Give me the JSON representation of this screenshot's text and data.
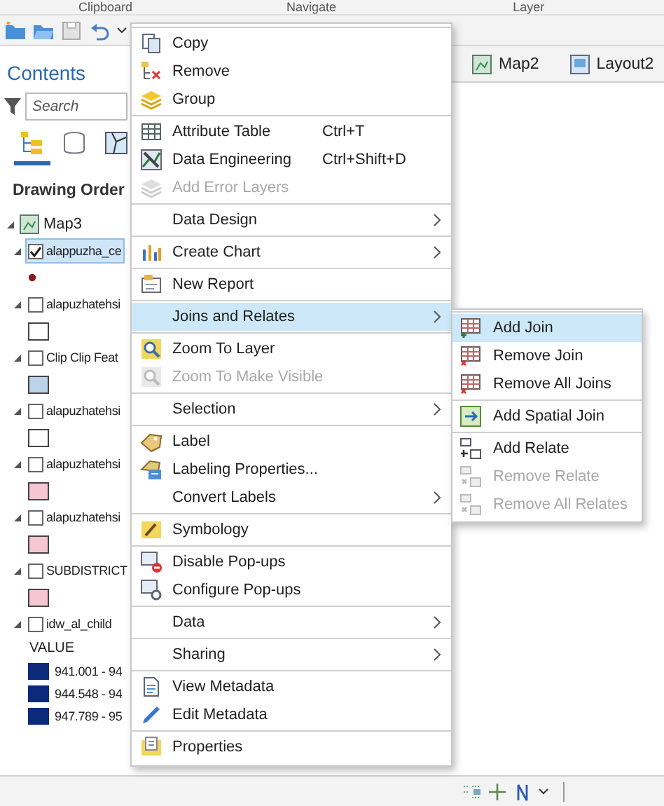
{
  "ribbon": {
    "groups": [
      "Clipboard",
      "Navigate",
      "Layer"
    ]
  },
  "map_tabs": [
    {
      "label": "Map2",
      "kind": "map"
    },
    {
      "label": "Layout2",
      "kind": "layout"
    }
  ],
  "contents": {
    "title": "Contents",
    "search": {
      "placeholder": "Search"
    },
    "views": [
      {
        "selected": true
      },
      {
        "selected": false
      },
      {
        "selected": false
      }
    ],
    "heading": "Drawing Order",
    "map": {
      "name": "Map3",
      "expanded": true,
      "layers": [
        {
          "name": "alappuzha_ce",
          "checked": true,
          "selected": true,
          "expanded": true,
          "symbol": {
            "kind": "point",
            "color": "#8b1a1a"
          }
        },
        {
          "name": "alapuzhatehsi",
          "checked": false,
          "selected": false,
          "expanded": true,
          "symbol": {
            "kind": "fill",
            "color": "#ffffff"
          }
        },
        {
          "name": "Clip Clip Feat",
          "checked": false,
          "selected": false,
          "expanded": true,
          "symbol": {
            "kind": "fill",
            "color": "#bcd3ea"
          }
        },
        {
          "name": "alapuzhatehsi",
          "checked": false,
          "selected": false,
          "expanded": true,
          "symbol": {
            "kind": "fill",
            "color": "#ffffff"
          }
        },
        {
          "name": "alapuzhatehsi",
          "checked": false,
          "selected": false,
          "expanded": true,
          "symbol": {
            "kind": "fill",
            "color": "#f7c6d3"
          }
        },
        {
          "name": "alapuzhatehsi",
          "checked": false,
          "selected": false,
          "expanded": true,
          "symbol": {
            "kind": "fill",
            "color": "#f7c6d3"
          }
        },
        {
          "name": "SUBDISTRICT",
          "checked": false,
          "selected": false,
          "expanded": true,
          "symbol": {
            "kind": "fill",
            "color": "#f7c6d3"
          }
        },
        {
          "name": "idw_al_child",
          "checked": false,
          "selected": false,
          "expanded": true,
          "symbol": {
            "kind": "ramp",
            "heading": "VALUE",
            "classes": [
              {
                "label": "941.001 - 94",
                "color": "#0b2a7c"
              },
              {
                "label": "944.548 - 94",
                "color": "#0b2a7c"
              },
              {
                "label": "947.789 - 95",
                "color": "#0b2a7c"
              }
            ]
          }
        }
      ]
    }
  },
  "context_menu": {
    "sections": [
      {
        "items": [
          {
            "label": "Copy",
            "submenu": false,
            "disabled": false,
            "selected": false
          },
          {
            "label": "Remove",
            "submenu": false,
            "disabled": false,
            "selected": false
          },
          {
            "label": "Group",
            "submenu": false,
            "disabled": false,
            "selected": false
          }
        ]
      },
      {
        "items": [
          {
            "label": "Attribute Table",
            "shortcut": "Ctrl+T",
            "submenu": false,
            "disabled": false,
            "selected": false
          },
          {
            "label": "Data Engineering",
            "shortcut": "Ctrl+Shift+D",
            "submenu": false,
            "disabled": false,
            "selected": false
          },
          {
            "label": "Add Error Layers",
            "submenu": false,
            "disabled": true,
            "selected": false
          }
        ]
      },
      {
        "items": [
          {
            "label": "Data Design",
            "submenu": true,
            "disabled": false,
            "selected": false
          }
        ]
      },
      {
        "items": [
          {
            "label": "Create Chart",
            "submenu": true,
            "disabled": false,
            "selected": false
          }
        ]
      },
      {
        "items": [
          {
            "label": "New Report",
            "submenu": false,
            "disabled": false,
            "selected": false
          }
        ]
      },
      {
        "items": [
          {
            "label": "Joins and Relates",
            "submenu": true,
            "disabled": false,
            "selected": true
          }
        ]
      },
      {
        "items": [
          {
            "label": "Zoom To Layer",
            "submenu": false,
            "disabled": false,
            "selected": false
          },
          {
            "label": "Zoom To Make Visible",
            "submenu": false,
            "disabled": true,
            "selected": false
          }
        ]
      },
      {
        "items": [
          {
            "label": "Selection",
            "submenu": true,
            "disabled": false,
            "selected": false
          }
        ]
      },
      {
        "items": [
          {
            "label": "Label",
            "submenu": false,
            "disabled": false,
            "selected": false
          },
          {
            "label": "Labeling Properties...",
            "submenu": false,
            "disabled": false,
            "selected": false
          },
          {
            "label": "Convert Labels",
            "submenu": true,
            "disabled": false,
            "selected": false
          }
        ]
      },
      {
        "items": [
          {
            "label": "Symbology",
            "submenu": false,
            "disabled": false,
            "selected": false
          }
        ]
      },
      {
        "items": [
          {
            "label": "Disable Pop-ups",
            "submenu": false,
            "disabled": false,
            "selected": false
          },
          {
            "label": "Configure Pop-ups",
            "submenu": false,
            "disabled": false,
            "selected": false
          }
        ]
      },
      {
        "items": [
          {
            "label": "Data",
            "submenu": true,
            "disabled": false,
            "selected": false
          }
        ]
      },
      {
        "items": [
          {
            "label": "Sharing",
            "submenu": true,
            "disabled": false,
            "selected": false
          }
        ]
      },
      {
        "items": [
          {
            "label": "View Metadata",
            "submenu": false,
            "disabled": false,
            "selected": false
          },
          {
            "label": "Edit Metadata",
            "submenu": false,
            "disabled": false,
            "selected": false
          }
        ]
      },
      {
        "items": [
          {
            "label": "Properties",
            "submenu": false,
            "disabled": false,
            "selected": false
          }
        ]
      }
    ]
  },
  "submenu": {
    "sections": [
      {
        "items": [
          {
            "label": "Add Join",
            "disabled": false,
            "selected": true
          },
          {
            "label": "Remove Join",
            "disabled": false,
            "selected": false
          },
          {
            "label": "Remove All Joins",
            "disabled": false,
            "selected": false
          }
        ]
      },
      {
        "items": [
          {
            "label": "Add Spatial Join",
            "disabled": false,
            "selected": false
          }
        ]
      },
      {
        "items": [
          {
            "label": "Add Relate",
            "disabled": false,
            "selected": false
          },
          {
            "label": "Remove Relate",
            "disabled": true,
            "selected": false
          },
          {
            "label": "Remove All Relates",
            "disabled": true,
            "selected": false
          }
        ]
      }
    ]
  }
}
